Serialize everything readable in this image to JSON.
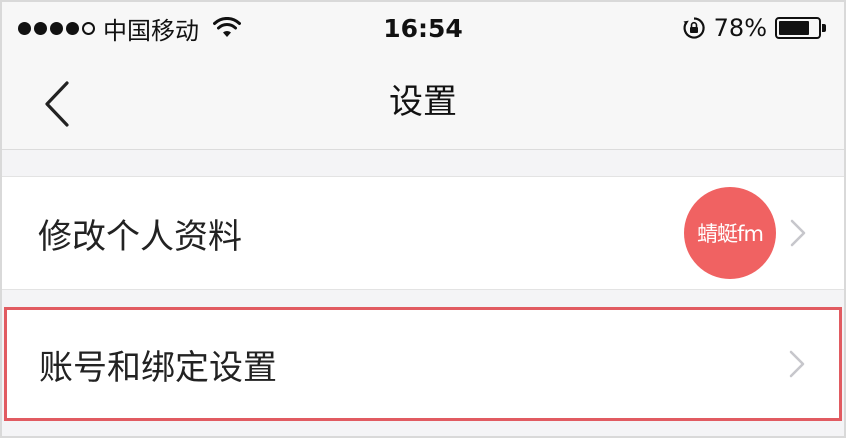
{
  "status_bar": {
    "carrier": "中国移动",
    "time": "16:54",
    "battery_percent": "78%",
    "battery_level": 0.78,
    "icons": [
      "signal-dots-icon",
      "wifi-icon",
      "rotation-lock-icon",
      "battery-icon"
    ]
  },
  "nav": {
    "title": "设置",
    "back_icon": "chevron-left-icon"
  },
  "list": {
    "items": [
      {
        "label": "修改个人资料",
        "avatar_text": "蜻蜓fm"
      },
      {
        "label": "账号和绑定设置"
      }
    ]
  },
  "colors": {
    "highlight_border": "#e15b61",
    "avatar_bg": "#f06262",
    "chevron": "#c7c7cc"
  }
}
